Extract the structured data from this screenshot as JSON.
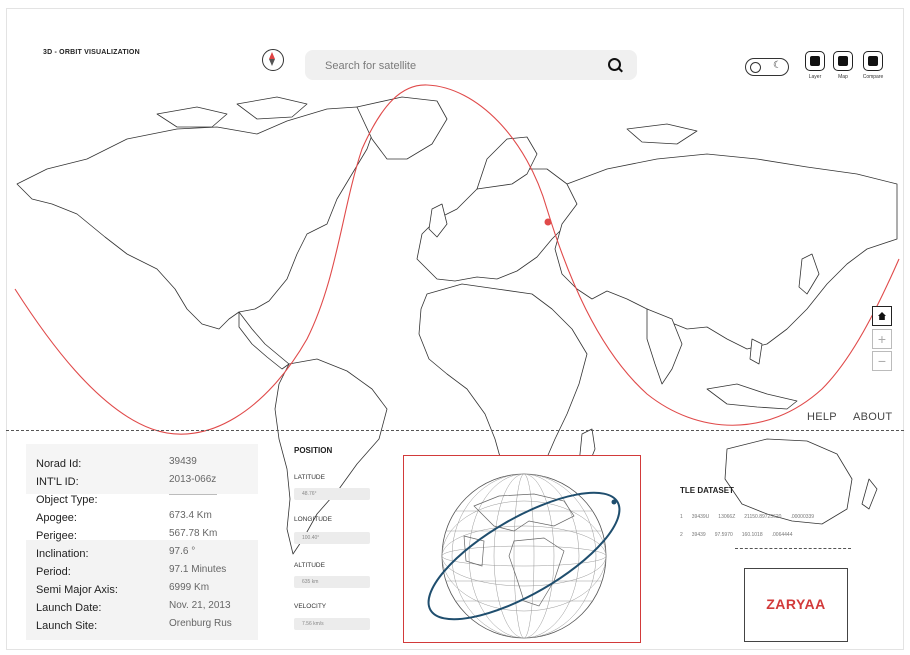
{
  "app": {
    "title": "3D - ORBIT VISUALIZATION"
  },
  "search": {
    "placeholder": "Search for satellite"
  },
  "toolbar": {
    "buttons": [
      {
        "label": "Layer",
        "icon": "layers-icon"
      },
      {
        "label": "Map",
        "icon": "map-icon"
      },
      {
        "label": "Compare",
        "icon": "compare-icon"
      }
    ]
  },
  "map_controls": {
    "home_icon": "home-icon",
    "zoom_in": "+",
    "zoom_out": "−"
  },
  "links": {
    "help": "HELP",
    "about": "ABOUT"
  },
  "satellite_info": {
    "rows": [
      {
        "label": "Norad Id:",
        "value": "39439"
      },
      {
        "label": "INT'L ID:",
        "value": "2013-066z"
      },
      {
        "label": "Object Type:",
        "value": "————————"
      },
      {
        "label": "Apogee:",
        "value": "673.4 Km"
      },
      {
        "label": "Perigee:",
        "value": "567.78 Km"
      },
      {
        "label": "Inclination:",
        "value": "97.6 °"
      },
      {
        "label": "Period:",
        "value": "97.1 Minutes"
      },
      {
        "label": "Semi Major Axis:",
        "value": "6999 Km"
      },
      {
        "label": "Launch Date:",
        "value": "Nov. 21, 2013"
      },
      {
        "label": "Launch Site:",
        "value": "Orenburg Rus"
      }
    ]
  },
  "position": {
    "title": "POSITION",
    "fields": [
      {
        "label": "LATITUDE",
        "value": "48.76°"
      },
      {
        "label": "LONGITUDE",
        "value": "100.40°"
      },
      {
        "label": "ALTITUDE",
        "value": "635 km"
      },
      {
        "label": "VELOCITY",
        "value": "7.56 km/s"
      }
    ]
  },
  "tle": {
    "title": "TLE DATASET",
    "lines": [
      [
        "1",
        "39439U",
        "13066Z",
        "21150.89723620",
        ".00000339"
      ],
      [
        "2",
        "39439",
        "97.5970",
        "160.1018",
        ".0064444"
      ]
    ]
  },
  "satellite_name": "ZARYAA",
  "colors": {
    "orbit_track": "#e04a4a",
    "satellite_marker": "#e04a4a",
    "globe_orbit": "#1f4e6e",
    "accent": "#d23a3a"
  }
}
